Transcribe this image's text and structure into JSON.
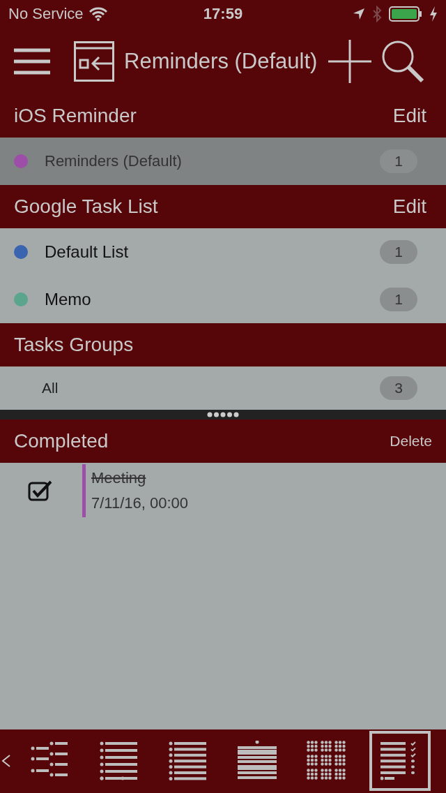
{
  "status_bar": {
    "carrier": "No Service",
    "time": "17:59"
  },
  "toolbar": {
    "title": "Reminders (Default)"
  },
  "sections": [
    {
      "title": "iOS Reminder",
      "action": "Edit",
      "lists": [
        {
          "name": "Reminders (Default)",
          "count": "1",
          "color": "#9c4ea8",
          "selected": true
        }
      ]
    },
    {
      "title": "Google Task List",
      "action": "Edit",
      "lists": [
        {
          "name": "Default List",
          "count": "1",
          "color": "#3a63b0",
          "selected": false
        },
        {
          "name": "Memo",
          "count": "1",
          "color": "#5aa58c",
          "selected": false
        }
      ]
    },
    {
      "title": "Tasks Groups",
      "lists": [
        {
          "name": "All",
          "count": "3",
          "selected": false
        }
      ]
    }
  ],
  "completed": {
    "title": "Completed",
    "action": "Delete",
    "tasks": [
      {
        "title": "Meeting",
        "date": "7/11/16, 00:00",
        "checked": true,
        "color": "#9c4ea8"
      }
    ]
  },
  "view_tabs": [
    {
      "kind": "tree",
      "selected": false
    },
    {
      "kind": "list",
      "selected": false
    },
    {
      "kind": "dense",
      "selected": false
    },
    {
      "kind": "bands",
      "selected": false
    },
    {
      "kind": "grid",
      "selected": false
    },
    {
      "kind": "checklist",
      "selected": true
    }
  ]
}
